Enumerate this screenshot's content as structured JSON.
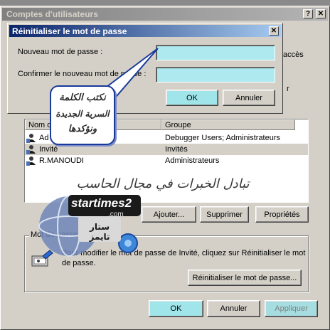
{
  "main_window": {
    "title": "Comptes d'utilisateurs",
    "help_label": "?",
    "close_label": "✕",
    "partial_right_text_1": "accès",
    "partial_right_text_2": "r"
  },
  "users_table": {
    "columns": [
      "Nom d'utilisateur",
      "Groupe"
    ],
    "visible_col1_header": "Nom d",
    "rows": [
      {
        "name": "Ad",
        "group": "Debugger Users; Administrateurs",
        "selected": false
      },
      {
        "name": "Invité",
        "group": "Invités",
        "selected": true
      },
      {
        "name": "R.MANOUDI",
        "group": "Administrateurs",
        "selected": false
      }
    ]
  },
  "user_buttons": {
    "add": "Ajouter...",
    "remove": "Supprimer",
    "properties": "Propriétés"
  },
  "password_group": {
    "title": "Mot de passe de Invité",
    "text_line1": "Pour modifier le mot de passe de Invité, cliquez sur Réinitialiser le mot",
    "text_line2": "de passe.",
    "reset_button": "Réinitialiser le mot de passe..."
  },
  "footer_buttons": {
    "ok": "OK",
    "cancel": "Annuler",
    "apply": "Appliquer"
  },
  "dialog": {
    "title": "Réinitialiser le mot de passe",
    "close_label": "✕",
    "new_password_label": "Nouveau mot de passe :",
    "new_password_value": "",
    "confirm_label": "Confirmer le nouveau mot de passe :",
    "confirm_value": "",
    "ok": "OK",
    "cancel": "Annuler"
  },
  "overlay": {
    "callout_lines": [
      "نكتب الكلمة",
      "السرية الجديدة",
      "ونؤكدها"
    ],
    "watermark_arabic": "تبادل الخبرات في مجال الحاسب",
    "logo_text": "startimes2",
    "logo_suffix": ".com",
    "logo_arabic": "ستار تايمز"
  },
  "colors": {
    "title_active": "#0a246a",
    "title_inactive": "#808080",
    "button_accent": "#9fe5ea",
    "input_accent": "#ade9ee",
    "callout_border": "#1a3a9a"
  }
}
